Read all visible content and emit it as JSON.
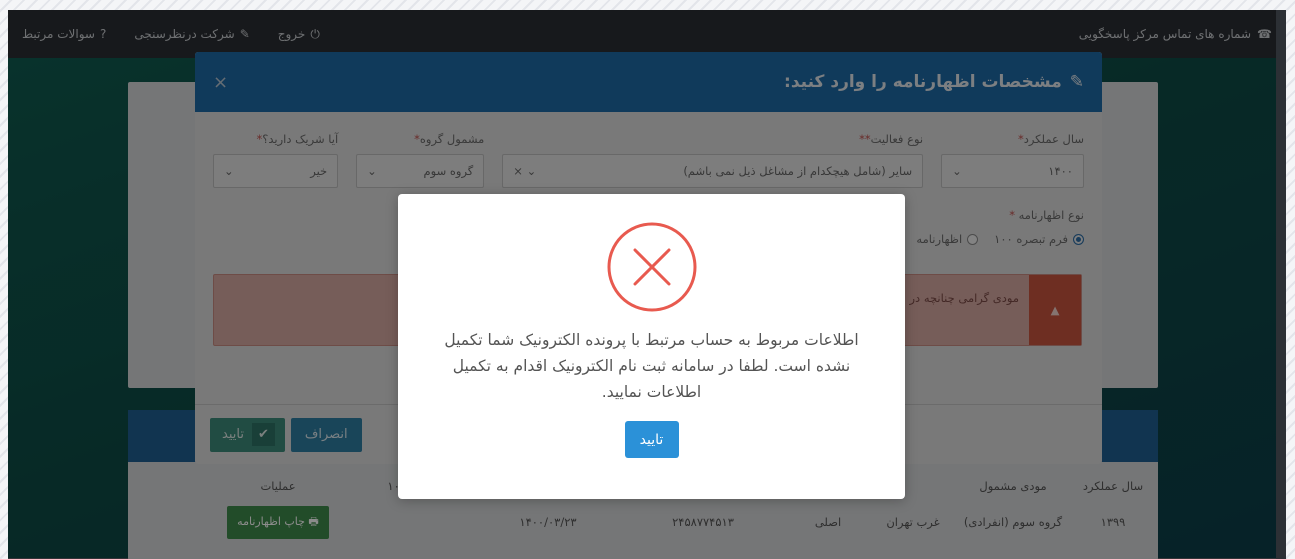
{
  "topbar": {
    "exit": "خروج",
    "survey": "شرکت درنظرسنجی",
    "related_questions": "سوالات مرتبط",
    "support_phones": "شماره های تماس مرکز پاسخگویی"
  },
  "modal": {
    "title": "مشخصات اظهارنامه را وارد کنید:",
    "fields": {
      "year_label": "سال عملکرد",
      "year_value": "۱۴۰۰",
      "activity_label": "نوع فعالیت",
      "activity_value": "سایر (شامل هیچکدام از مشاغل ذیل نمی باشم)",
      "group_label": "مشمول گروه",
      "group_value": "گروه سوم",
      "partner_label": "آیا شریک دارید؟",
      "partner_value": "خیر"
    },
    "declaration_type_label": "نوع اظهارنامه",
    "radio_options": [
      "فرم تبصره ۱۰۰",
      "اظهارنامه"
    ],
    "alert_text": "مودی گرامی چنانچه در ... سکه دریافتی به صورت مجزا و بر اساس ...",
    "confirm": "تایید",
    "cancel": "انصراف"
  },
  "background_table": {
    "headers": [
      "سال عملکرد",
      "مودی مشمول",
      "",
      "",
      "",
      "",
      "تبصره ۱۰۰",
      "عملیات"
    ],
    "row": [
      "۱۳۹۹",
      "گروه سوم (انفرادی)",
      "غرب تهران",
      "اصلی",
      "۲۴۵۸۷۷۴۵۱۳",
      "۱۴۰۰/۰۳/۲۳",
      "",
      "چاپ اظهارنامه"
    ]
  },
  "dialog": {
    "message": "اطلاعات مربوط به حساب مرتبط با پرونده الکترونیک شما تکمیل نشده است. لطفا در سامانه ثبت نام الکترونیک اقدام به تکمیل اطلاعات نمایید.",
    "ok": "تایید"
  },
  "colors": {
    "dialog_error": "#e85a4f",
    "dialog_ok_button": "#2b91d8",
    "modal_header": "#1e6aa6"
  }
}
